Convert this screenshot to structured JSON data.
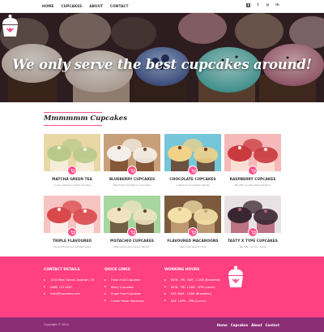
{
  "nav": {
    "items": [
      "HOME",
      "CUPCAKES",
      "ABOUT",
      "CONTACT"
    ],
    "social_icons": [
      "facebook-icon",
      "twitter-icon",
      "pinterest-icon",
      "linkedin-icon"
    ]
  },
  "hero": {
    "title": "We only serve the best cupcakes around!"
  },
  "section": {
    "title": "Mmmmmm Cupcakes"
  },
  "products": [
    {
      "name": "MATCHA GREEN TEA",
      "desc": "A very delicious mocha cupcake",
      "colors": [
        "#e9d7a6",
        "#b9c98a",
        "#f7f1e2"
      ]
    },
    {
      "name": "BLUEBERRY CUPCAKES",
      "desc": "Best fresh fruit flavour Cupcakes",
      "colors": [
        "#c7a07a",
        "#f5efe9",
        "#7a4a2e"
      ]
    },
    {
      "name": "CHOCOLATE CUPCAKES",
      "desc": "A delicious chocolate cupcake",
      "colors": [
        "#74c6d8",
        "#f1d289",
        "#6a3c27"
      ]
    },
    {
      "name": "RASPBERRY CUPCAKES",
      "desc": "We offer you the best raspberry",
      "colors": [
        "#f4b9b8",
        "#c83a3d",
        "#fbe5d8"
      ]
    },
    {
      "name": "TRIPLE FLAVOURED",
      "desc": "Several flavoured cupcake types",
      "colors": [
        "#f6c4c2",
        "#d9484b",
        "#fff4ef"
      ]
    },
    {
      "name": "PISTACHIO CUPCAKES",
      "desc": "What about some green flavour?",
      "colors": [
        "#a7d6a0",
        "#f1e3c1",
        "#6a4a32"
      ]
    },
    {
      "name": "FLAVOURED MACAROONS",
      "desc": "Tasty Cupcakes for kids",
      "colors": [
        "#7c5a3d",
        "#f4e1a9",
        "#c9a37a"
      ]
    },
    {
      "name": "TASTY X TYPE CUPCAKES",
      "desc": "We offer you four types",
      "colors": [
        "#e8e2e4",
        "#3a2630",
        "#b35f73"
      ]
    }
  ],
  "footer": {
    "contact": {
      "heading": "CONTACT DETAILS",
      "items": [
        "1234 Main Street, Anytown, TX",
        "(888) 123 4567",
        "hello@cupcakes.com"
      ]
    },
    "links": {
      "heading": "QUICK LINKS",
      "items": [
        "Fresh Fruit Cupcakes",
        "Minty Cupcakes",
        "Sugar Free Cupcakes",
        "Carrot Flavor Macarons"
      ]
    },
    "hours": {
      "heading": "WORKING HOURS",
      "items": [
        "MON - FRI: 7AM - 11AM (Breakfast)",
        "MON - FRI: 11AM - 3PM (Lunch)",
        "SAT: 8AM - 12AM (Breakfast)",
        "SAT: 12PM - 3PM (Lunch)"
      ]
    }
  },
  "bottom": {
    "copyright": "Copyright © 2014",
    "nav": [
      "Home",
      "Cupcakes",
      "About",
      "Contact"
    ]
  },
  "colors": {
    "accent": "#ff4081",
    "bottom_bar": "#8b2d75"
  }
}
